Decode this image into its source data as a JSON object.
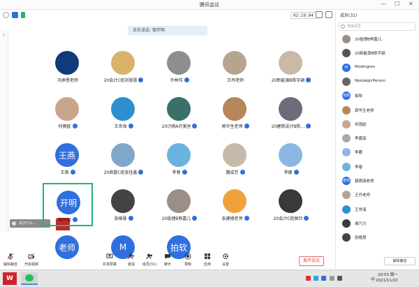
{
  "window": {
    "title": "腾讯会议"
  },
  "topbar": {
    "timer": "02:19:04"
  },
  "speaking": {
    "label": "正在讲话: 邹开明"
  },
  "chat_hint": {
    "text": "说点什么..."
  },
  "colors": {
    "accent": "#2f6fde",
    "active_border": "#22b573",
    "danger": "#e04545"
  },
  "participants": [
    {
      "name": "冯承恩老师",
      "color": "#123a7a",
      "avatar_text": "",
      "badge": false
    },
    {
      "name": "20会计C班刘慧慧",
      "color": "#d9b26b",
      "avatar_text": "",
      "badge": true
    },
    {
      "name": "许林伟",
      "color": "#8e8e8e",
      "avatar_text": "",
      "badge": true
    },
    {
      "name": "王丹老师",
      "color": "#b5a58e",
      "avatar_text": "",
      "badge": false
    },
    {
      "name": "20新能源B陈宇颖",
      "color": "#c9b9a6",
      "avatar_text": "",
      "badge": true
    },
    {
      "name": "何雨欧",
      "color": "#caa58d",
      "avatar_text": "",
      "badge": true
    },
    {
      "name": "王世海",
      "color": "#2d8fcf",
      "avatar_text": "",
      "badge": true
    },
    {
      "name": "20计网A许美垣",
      "color": "#3c6f6a",
      "avatar_text": "",
      "badge": true
    },
    {
      "name": "郭华生老师",
      "color": "#b6865a",
      "avatar_text": "",
      "badge": true
    },
    {
      "name": "20建筑设计B陈…",
      "color": "#6d6c7a",
      "avatar_text": "",
      "badge": true
    },
    {
      "name": "王燕",
      "color": "#2f6fde",
      "avatar_text": "王燕",
      "badge": true
    },
    {
      "name": "20商管C班张任鑫",
      "color": "#7fa7c9",
      "avatar_text": "",
      "badge": true
    },
    {
      "name": "李巷",
      "color": "#6ab3e0",
      "avatar_text": "",
      "badge": true
    },
    {
      "name": "魏成芳",
      "color": "#c7b8aa",
      "avatar_text": "",
      "badge": true
    },
    {
      "name": "李娜",
      "color": "#8db7e3",
      "avatar_text": "",
      "badge": true
    },
    {
      "name": "邹开明",
      "color": "#2f6fde",
      "avatar_text": "开明",
      "badge": true
    },
    {
      "name": "张格慧",
      "color": "#444444",
      "avatar_text": "",
      "badge": true
    },
    {
      "name": "20投理B熊嘉儿",
      "color": "#9a8e86",
      "avatar_text": "",
      "badge": true
    },
    {
      "name": "张建德老师",
      "color": "#f0a23a",
      "avatar_text": "",
      "badge": true
    },
    {
      "name": "20会计C班佩玲",
      "color": "#3a3a3a",
      "avatar_text": "",
      "badge": true
    },
    {
      "name": "",
      "color": "#2f6fde",
      "avatar_text": "老师",
      "badge": false
    },
    {
      "name": "",
      "color": "#2f6fde",
      "avatar_text": "M",
      "badge": false
    },
    {
      "name": "",
      "color": "#2f6fde",
      "avatar_text": "拍软",
      "badge": false
    }
  ],
  "toolbar": {
    "mic": "解除静音",
    "video": "开启视频",
    "share": "共享屏幕",
    "invite": "邀请",
    "members": "成员(31)",
    "chat": "聊天",
    "record": "录制",
    "apps": "应用",
    "settings": "设置",
    "open_meeting": "离开会议"
  },
  "panel": {
    "header": "成员(31)",
    "search_placeholder": "搜索成员",
    "unmute_all": "解除静音",
    "members": [
      {
        "name": "20投理B熊嘉儿",
        "color": "#9a8e86",
        "avatar_text": ""
      },
      {
        "name": "20新能源B陈宇颖",
        "color": "#555555",
        "avatar_text": ""
      },
      {
        "name": "Modingren",
        "color": "#2f6fde",
        "avatar_text": "M"
      },
      {
        "name": "NostalgicPerson",
        "color": "#666666",
        "avatar_text": ""
      },
      {
        "name": "拍软",
        "color": "#2f6fde",
        "avatar_text": "拍软"
      },
      {
        "name": "郭华生老师",
        "color": "#b6865a",
        "avatar_text": ""
      },
      {
        "name": "何雨欧",
        "color": "#caa58d",
        "avatar_text": ""
      },
      {
        "name": "李嘉琛",
        "color": "#a9a9a9",
        "avatar_text": ""
      },
      {
        "name": "李娜",
        "color": "#8db7e3",
        "avatar_text": ""
      },
      {
        "name": "李巷",
        "color": "#6ab3e0",
        "avatar_text": ""
      },
      {
        "name": "聂燕丽老师",
        "color": "#2f6fde",
        "avatar_text": "老师"
      },
      {
        "name": "王丹老师",
        "color": "#b5a58e",
        "avatar_text": ""
      },
      {
        "name": "王世海",
        "color": "#2d8fcf",
        "avatar_text": ""
      },
      {
        "name": "谢乃力",
        "color": "#3a3a3a",
        "avatar_text": ""
      },
      {
        "name": "张格慧",
        "color": "#444444",
        "avatar_text": ""
      }
    ]
  },
  "taskbar": {
    "time": "20:53 周一",
    "date": "2021/11/22",
    "lang": "中"
  }
}
